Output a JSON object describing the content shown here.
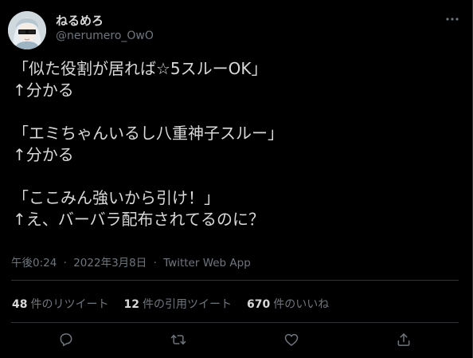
{
  "user": {
    "display_name": "ねるめろ",
    "handle": "@nerumero_OwO"
  },
  "tweet": {
    "lines": [
      "「似た役割が居れば☆5スルーOK」",
      "↑分かる",
      "",
      "「エミちゃんいるし八重神子スルー」",
      "↑分かる",
      "",
      "「ここみん強いから引け！」",
      "↑え、バーバラ配布されてるのに？"
    ],
    "time": "午後0:24",
    "date": "2022年3月8日",
    "source": "Twitter Web App",
    "separator": "·"
  },
  "stats": {
    "retweets": {
      "count": "48",
      "label": "件のリツイート"
    },
    "quotes": {
      "count": "12",
      "label": "件の引用ツイート"
    },
    "likes": {
      "count": "670",
      "label": "件のいいね"
    }
  },
  "icons": [
    "more-icon",
    "reply-icon",
    "retweet-icon",
    "like-icon",
    "share-icon"
  ],
  "colors": {
    "background": "#000000",
    "text": "#d9d9d9",
    "muted": "#6e767d",
    "divider": "#2f3336"
  }
}
